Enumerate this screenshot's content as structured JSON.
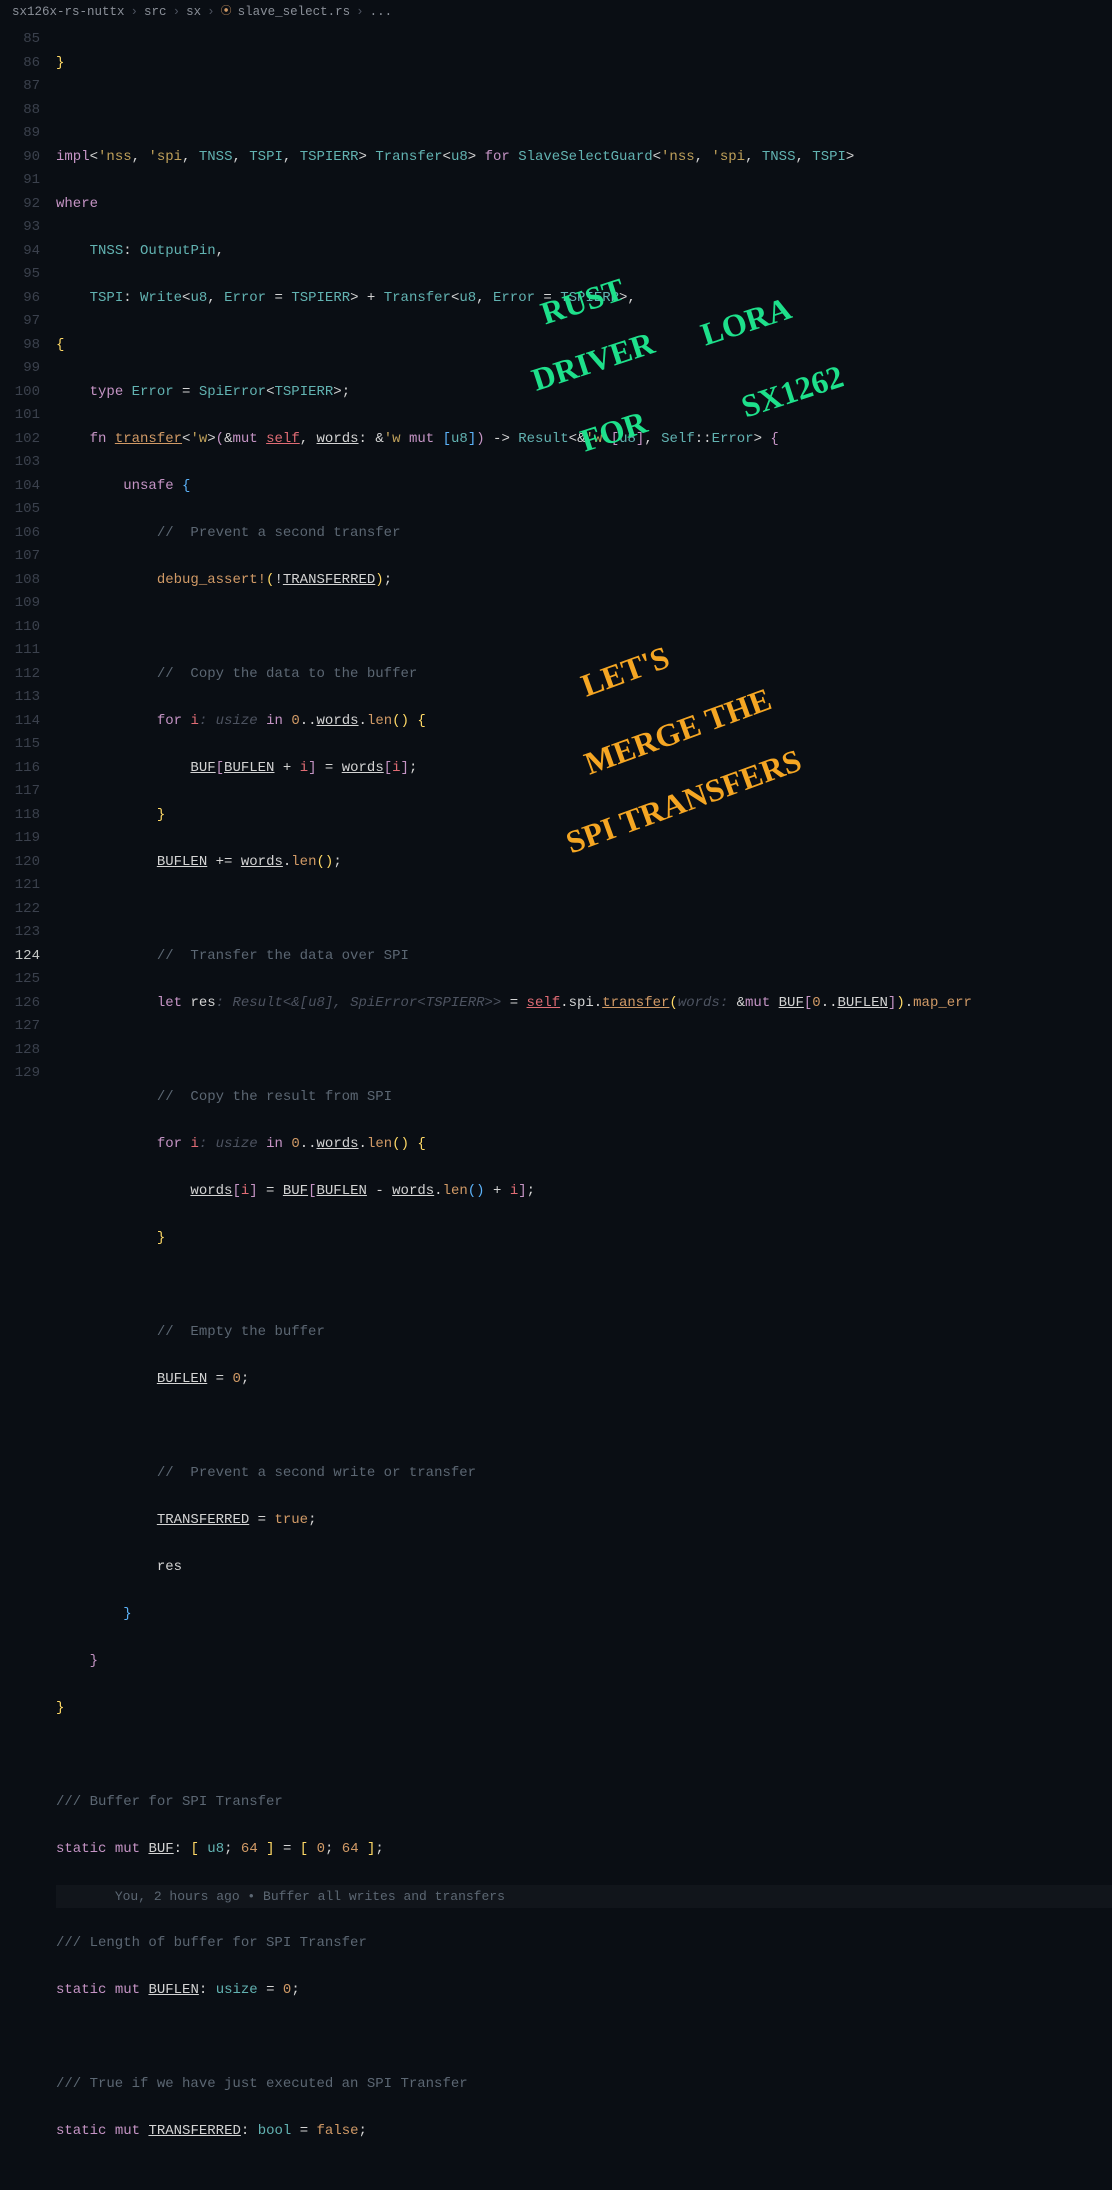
{
  "breadcrumb": {
    "parts": [
      "sx126x-rs-nuttx",
      "src",
      "sx",
      "slave_select.rs",
      "..."
    ],
    "file_icon": "⦿"
  },
  "gutter": {
    "start": 85,
    "end": 129,
    "current": 124
  },
  "annotations": {
    "green1": "RUST",
    "green2": "DRIVER",
    "green3": "FOR",
    "green4": "LORA",
    "green5": "SX1262",
    "orange1": "LET'S",
    "orange2": "MERGE THE",
    "orange3": "SPI TRANSFERS"
  },
  "code": {
    "l85": "}",
    "impl_kw": "impl",
    "for_kw": "for",
    "where_kw": "where",
    "tnss": "TNSS",
    "tspi": "TSPI",
    "tspierr": "TSPIERR",
    "transfer": "Transfer",
    "u8": "u8",
    "slaveselectguard": "SlaveSelectGuard",
    "lt_nss": "'nss",
    "lt_spi": "'spi",
    "lt_w": "'w",
    "outputpin": "OutputPin",
    "write": "Write",
    "error": "Error",
    "type_kw": "type",
    "spierror": "SpiError",
    "fn_kw": "fn",
    "transfer_fn": "transfer",
    "mut_kw": "mut",
    "self_kw": "self",
    "words": "words",
    "result": "Result",
    "self_ty": "Self",
    "unsafe_kw": "unsafe",
    "cm_prevent": "//  Prevent a second transfer",
    "debug_assert": "debug_assert!",
    "transferred": "TRANSFERRED",
    "cm_copy_to": "//  Copy the data to the buffer",
    "for_loop_kw": "for",
    "i": "i",
    "usize": "usize",
    "in_kw": "in",
    "len": "len",
    "buf": "BUF",
    "buflen": "BUFLEN",
    "cm_transfer": "//  Transfer the data over SPI",
    "let_kw": "let",
    "res": "res",
    "hint_result": ": Result<&[u8], SpiError<TSPIERR>> ",
    "spi": "spi",
    "hint_words": "words: ",
    "map_err": "map_err",
    "cm_copy_from": "//  Copy the result from SPI",
    "cm_empty": "//  Empty the buffer",
    "zero": "0",
    "cm_prevent2": "//  Prevent a second write or transfer",
    "true": "true",
    "false": "false",
    "cm_buf": "/// Buffer for SPI Transfer",
    "static_kw": "static",
    "arr64": "64",
    "codelens": "You, 2 hours ago • Buffer all writes and transfers",
    "cm_buflen": "/// Length of buffer for SPI Transfer",
    "cm_transferred": "/// True if we have just executed an SPI Transfer",
    "bool": "bool"
  }
}
